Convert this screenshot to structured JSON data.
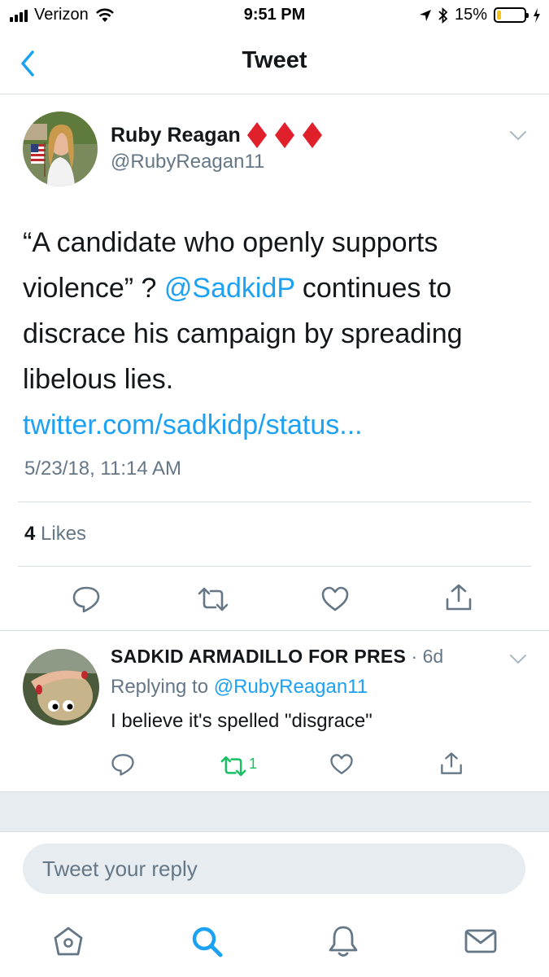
{
  "status_bar": {
    "carrier": "Verizon",
    "time": "9:51 PM",
    "battery_percent": "15%",
    "battery_level": 0.15,
    "battery_color": "#f5c518"
  },
  "nav": {
    "title": "Tweet",
    "back_icon": "chevron-left-icon"
  },
  "tweet": {
    "author_name": "Ruby Reagan",
    "author_handle": "@RubyReagan11",
    "name_emoji": "diamond-suits",
    "text_before_mention": "“A candidate who openly supports violence” ? ",
    "mention": "@SadkidP",
    "text_after_mention": " continues to discrace his campaign by spreading libelous lies. ",
    "link": "twitter.com/sadkidp/status...",
    "timestamp": "5/23/18, 11:14 AM",
    "likes_count": "4",
    "likes_label": "Likes"
  },
  "reply": {
    "author_name": "SADKID ARMADILLO FOR PRES",
    "time": " · 6d",
    "replying_label": "Replying to ",
    "replying_handle": "@RubyReagan11",
    "text": "I believe it's spelled \"disgrace\"",
    "retweet_count": "1"
  },
  "composer": {
    "placeholder": "Tweet your reply"
  },
  "colors": {
    "accent": "#1da1f2",
    "secondary_text": "#657786",
    "retweet_green": "#17bf63",
    "diamond_red": "#e0202b"
  },
  "tabbar": [
    "home-icon",
    "search-icon",
    "notifications-icon",
    "messages-icon"
  ]
}
